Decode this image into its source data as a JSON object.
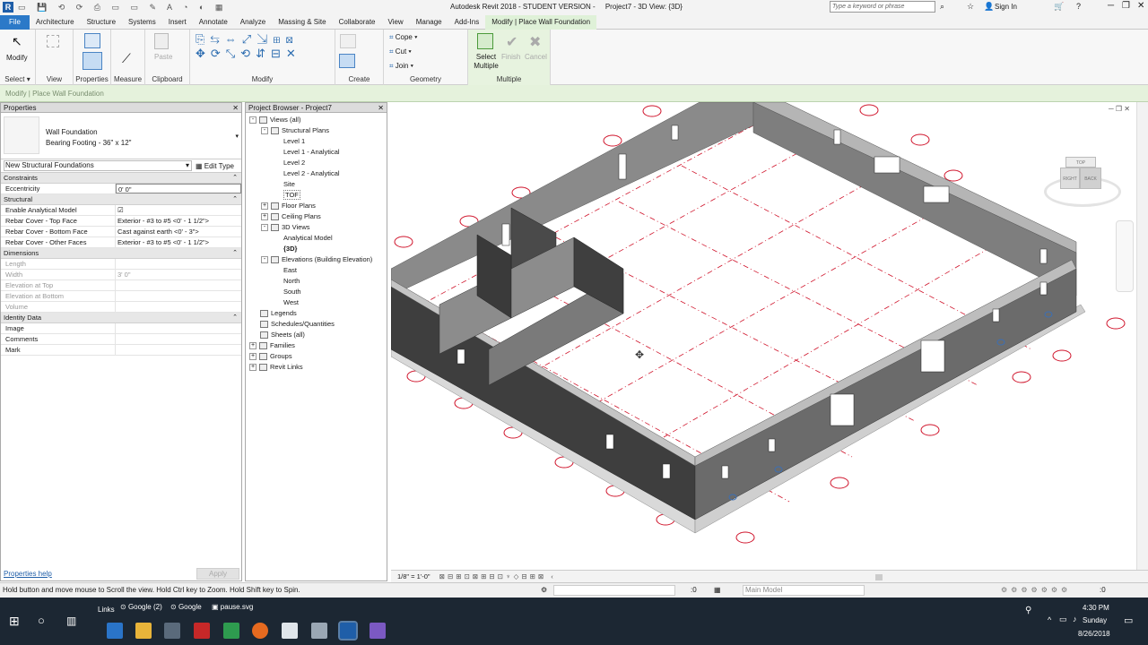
{
  "titlebar": {
    "app_title": "Autodesk Revit 2018 - STUDENT VERSION -",
    "doc_title": "Project7 - 3D View: {3D}",
    "search_placeholder": "Type a keyword or phrase",
    "sign_in": "Sign In"
  },
  "menu": {
    "tabs": [
      "File",
      "Architecture",
      "Structure",
      "Systems",
      "Insert",
      "Annotate",
      "Analyze",
      "Massing & Site",
      "Collaborate",
      "View",
      "Manage",
      "Add-Ins",
      "Modify | Place Wall Foundation"
    ]
  },
  "ribbon": {
    "modify_label": "Modify",
    "select_label": "Select",
    "groups": {
      "view": "View",
      "properties": "Properties",
      "measure": "Measure",
      "clipboard": "Clipboard",
      "modify": "Modify",
      "create": "Create",
      "geometry": "Geometry",
      "multiple": "Multiple"
    },
    "paste_label": "Paste",
    "cope_label": "Cope",
    "cut_label": "Cut",
    "join_label": "Join",
    "select_multiple_label": "Select Multiple",
    "finish_label": "Finish",
    "cancel_label": "Cancel"
  },
  "optionsbar": {
    "text": "Modify | Place Wall Foundation"
  },
  "properties": {
    "title": "Properties",
    "type_family": "Wall Foundation",
    "type_name": "Bearing Footing - 36\" x 12\"",
    "instance_filter": "New Structural Foundations",
    "edit_type": "Edit Type",
    "sections": [
      {
        "name": "Constraints",
        "rows": [
          {
            "k": "Eccentricity",
            "v": "0'  0\"",
            "dis": false
          }
        ]
      },
      {
        "name": "Structural",
        "rows": [
          {
            "k": "Enable Analytical Model",
            "v": "☑",
            "dis": false
          },
          {
            "k": "Rebar Cover - Top Face",
            "v": "Exterior - #3 to #5 <0' - 1 1/2\">",
            "dis": false
          },
          {
            "k": "Rebar Cover - Bottom Face",
            "v": "Cast against earth <0' - 3\">",
            "dis": false
          },
          {
            "k": "Rebar Cover - Other Faces",
            "v": "Exterior - #3 to #5 <0' - 1 1/2\">",
            "dis": false
          }
        ]
      },
      {
        "name": "Dimensions",
        "rows": [
          {
            "k": "Length",
            "v": "",
            "dis": true
          },
          {
            "k": "Width",
            "v": "3'  0\"",
            "dis": true
          },
          {
            "k": "Elevation at Top",
            "v": "",
            "dis": true
          },
          {
            "k": "Elevation at Bottom",
            "v": "",
            "dis": true
          },
          {
            "k": "Volume",
            "v": "",
            "dis": true
          }
        ]
      },
      {
        "name": "Identity Data",
        "rows": [
          {
            "k": "Image",
            "v": "",
            "dis": false
          },
          {
            "k": "Comments",
            "v": "",
            "dis": false
          },
          {
            "k": "Mark",
            "v": "",
            "dis": false
          }
        ]
      }
    ],
    "help": "Properties help",
    "apply": "Apply"
  },
  "browser": {
    "title": "Project Browser - Project7",
    "nodes": [
      {
        "indent": 0,
        "tog": "-",
        "label": "Views (all)",
        "bold": false
      },
      {
        "indent": 1,
        "tog": "-",
        "label": "Structural Plans",
        "bold": false
      },
      {
        "indent": 2,
        "tog": "",
        "label": "Level 1",
        "bold": false
      },
      {
        "indent": 2,
        "tog": "",
        "label": "Level 1 - Analytical",
        "bold": false
      },
      {
        "indent": 2,
        "tog": "",
        "label": "Level 2",
        "bold": false
      },
      {
        "indent": 2,
        "tog": "",
        "label": "Level 2 - Analytical",
        "bold": false
      },
      {
        "indent": 2,
        "tog": "",
        "label": "Site",
        "bold": false
      },
      {
        "indent": 2,
        "tog": "",
        "label": "TOF",
        "bold": false
      },
      {
        "indent": 1,
        "tog": "+",
        "label": "Floor Plans",
        "bold": false
      },
      {
        "indent": 1,
        "tog": "+",
        "label": "Ceiling Plans",
        "bold": false
      },
      {
        "indent": 1,
        "tog": "-",
        "label": "3D Views",
        "bold": false
      },
      {
        "indent": 2,
        "tog": "",
        "label": "Analytical Model",
        "bold": false
      },
      {
        "indent": 2,
        "tog": "",
        "label": "{3D}",
        "bold": true
      },
      {
        "indent": 1,
        "tog": "-",
        "label": "Elevations (Building Elevation)",
        "bold": false
      },
      {
        "indent": 2,
        "tog": "",
        "label": "East",
        "bold": false
      },
      {
        "indent": 2,
        "tog": "",
        "label": "North",
        "bold": false
      },
      {
        "indent": 2,
        "tog": "",
        "label": "South",
        "bold": false
      },
      {
        "indent": 2,
        "tog": "",
        "label": "West",
        "bold": false
      },
      {
        "indent": 0,
        "tog": "",
        "label": "Legends",
        "bold": false
      },
      {
        "indent": 0,
        "tog": "",
        "label": "Schedules/Quantities",
        "bold": false
      },
      {
        "indent": 0,
        "tog": "",
        "label": "Sheets (all)",
        "bold": false
      },
      {
        "indent": 0,
        "tog": "+",
        "label": "Families",
        "bold": false
      },
      {
        "indent": 0,
        "tog": "+",
        "label": "Groups",
        "bold": false
      },
      {
        "indent": 0,
        "tog": "+",
        "label": "Revit Links",
        "bold": false
      }
    ]
  },
  "viewcube": {
    "right": "RIGHT",
    "back": "BACK",
    "top": "TOP"
  },
  "viewbar": {
    "scale": "1/8\" = 1'-0\""
  },
  "status": {
    "text": "Hold button and move mouse to Scroll the view. Hold Ctrl key to Zoom. Hold Shift key to Spin.",
    "worksets": ":0",
    "model": "Main Model",
    "filter": ":0"
  },
  "taskbar": {
    "links": "Links",
    "items": [
      "Google (2)",
      "Google",
      "pause.svg"
    ],
    "time": "4:30 PM",
    "day": "Sunday",
    "date": "8/26/2018"
  },
  "colors": {
    "accent": "#2b79c8",
    "context": "#dff1d8",
    "grid": "#d0152c",
    "wall": "#3e3e3e"
  }
}
